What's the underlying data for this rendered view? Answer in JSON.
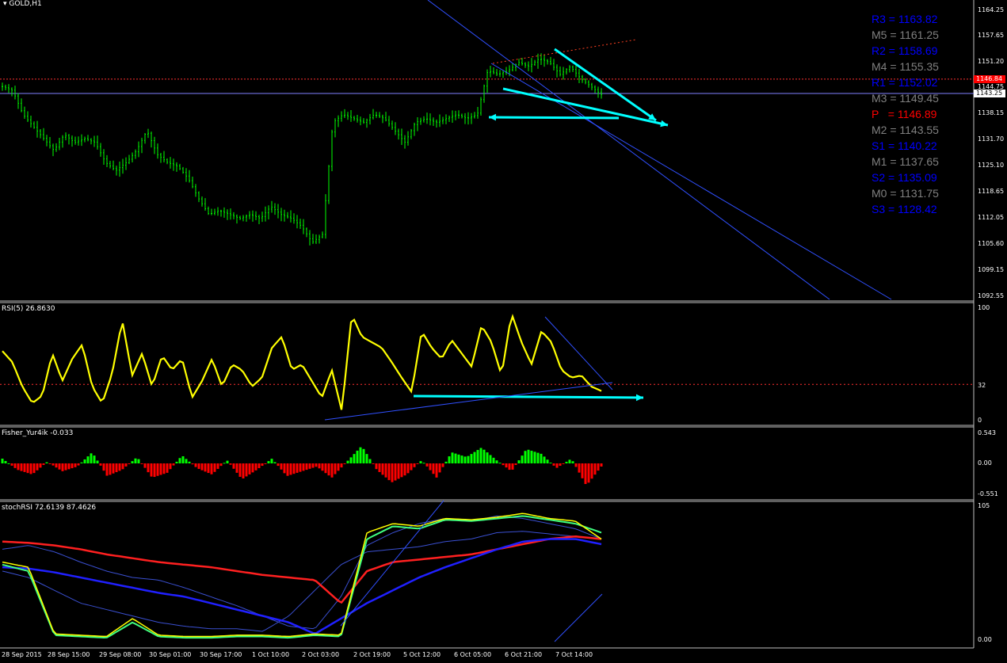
{
  "header": {
    "symbol_timeframe": "GOLD,H1"
  },
  "pivots": [
    {
      "label": "R3 = 1163.82",
      "color": "#0000ff"
    },
    {
      "label": "M5 = 1161.25",
      "color": "#808080"
    },
    {
      "label": "R2 = 1158.69",
      "color": "#0000ff"
    },
    {
      "label": "M4 = 1155.35",
      "color": "#808080"
    },
    {
      "label": "R1 = 1152.02",
      "color": "#0000ff"
    },
    {
      "label": "M3 = 1149.45",
      "color": "#808080"
    },
    {
      "label": "P   = 1146.89",
      "color": "#ff0000"
    },
    {
      "label": "M2 = 1143.55",
      "color": "#808080"
    },
    {
      "label": "S1 = 1140.22",
      "color": "#0000ff"
    },
    {
      "label": "M1 = 1137.65",
      "color": "#808080"
    },
    {
      "label": "S2 = 1135.09",
      "color": "#0000ff"
    },
    {
      "label": "M0 = 1131.75",
      "color": "#808080"
    },
    {
      "label": "S3 = 1128.42",
      "color": "#0000ff"
    }
  ],
  "price_ticks": [
    "1164.25",
    "1157.65",
    "1151.20",
    "1144.75",
    "1138.15",
    "1131.70",
    "1125.10",
    "1118.65",
    "1112.05",
    "1105.60",
    "1099.15",
    "1092.55"
  ],
  "price_labels": {
    "bid": "1146.84",
    "current": "1143.25"
  },
  "time_ticks": [
    "28 Sep 2015",
    "28 Sep 15:00",
    "29 Sep 08:00",
    "30 Sep 01:00",
    "30 Sep 17:00",
    "1 Oct 10:00",
    "2 Oct 03:00",
    "2 Oct 19:00",
    "5 Oct 12:00",
    "6 Oct 05:00",
    "6 Oct 21:00",
    "7 Oct 14:00"
  ],
  "rsi": {
    "title": "RSI(5) 26.8630",
    "ticks": [
      "100",
      "32",
      "0"
    ]
  },
  "fisher": {
    "title": "Fisher_Yur4ik -0.033",
    "ticks": [
      "0.543",
      "0.00",
      "-0.551"
    ]
  },
  "stoch": {
    "title": "stochRSI 72.6139 87.4626",
    "ticks": [
      "105",
      "0.00"
    ]
  },
  "colors": {
    "background": "#000000",
    "candles": "#00ff00",
    "rsi_line": "#ffff00",
    "fisher_positive": "#00ff00",
    "fisher_negative": "#ff0000",
    "arrows": "#00ffff",
    "channel": "#3050ff",
    "stoch_fast": "#ffff00",
    "stoch_slow": "#40ff80",
    "stoch_ma_long": "#ff2020",
    "stoch_ma_slow": "#2020ff"
  },
  "chart_data": {
    "type": "line",
    "symbol": "GOLD",
    "timeframe": "H1",
    "ylim": [
      1092.55,
      1164.25
    ],
    "close_series": [
      1145,
      1144,
      1138,
      1135,
      1132,
      1129,
      1133,
      1131,
      1132,
      1131,
      1126,
      1124,
      1126,
      1129,
      1134,
      1128,
      1126,
      1125,
      1122,
      1117,
      1113,
      1114,
      1113,
      1112,
      1113,
      1112,
      1115,
      1113,
      1112,
      1110,
      1106,
      1108,
      1136,
      1138,
      1137,
      1136,
      1138,
      1137,
      1134,
      1131,
      1136,
      1137,
      1136,
      1137,
      1138,
      1137,
      1138,
      1149,
      1148,
      1149,
      1151,
      1150,
      1152,
      1151,
      1148,
      1150,
      1147,
      1145,
      1143
    ],
    "series": [
      {
        "name": "RSI(5)",
        "last": 26.863,
        "level": 32
      },
      {
        "name": "Fisher_Yur4ik",
        "last": -0.033
      },
      {
        "name": "stochRSI",
        "values_last": [
          72.6139,
          87.4626
        ]
      }
    ]
  }
}
